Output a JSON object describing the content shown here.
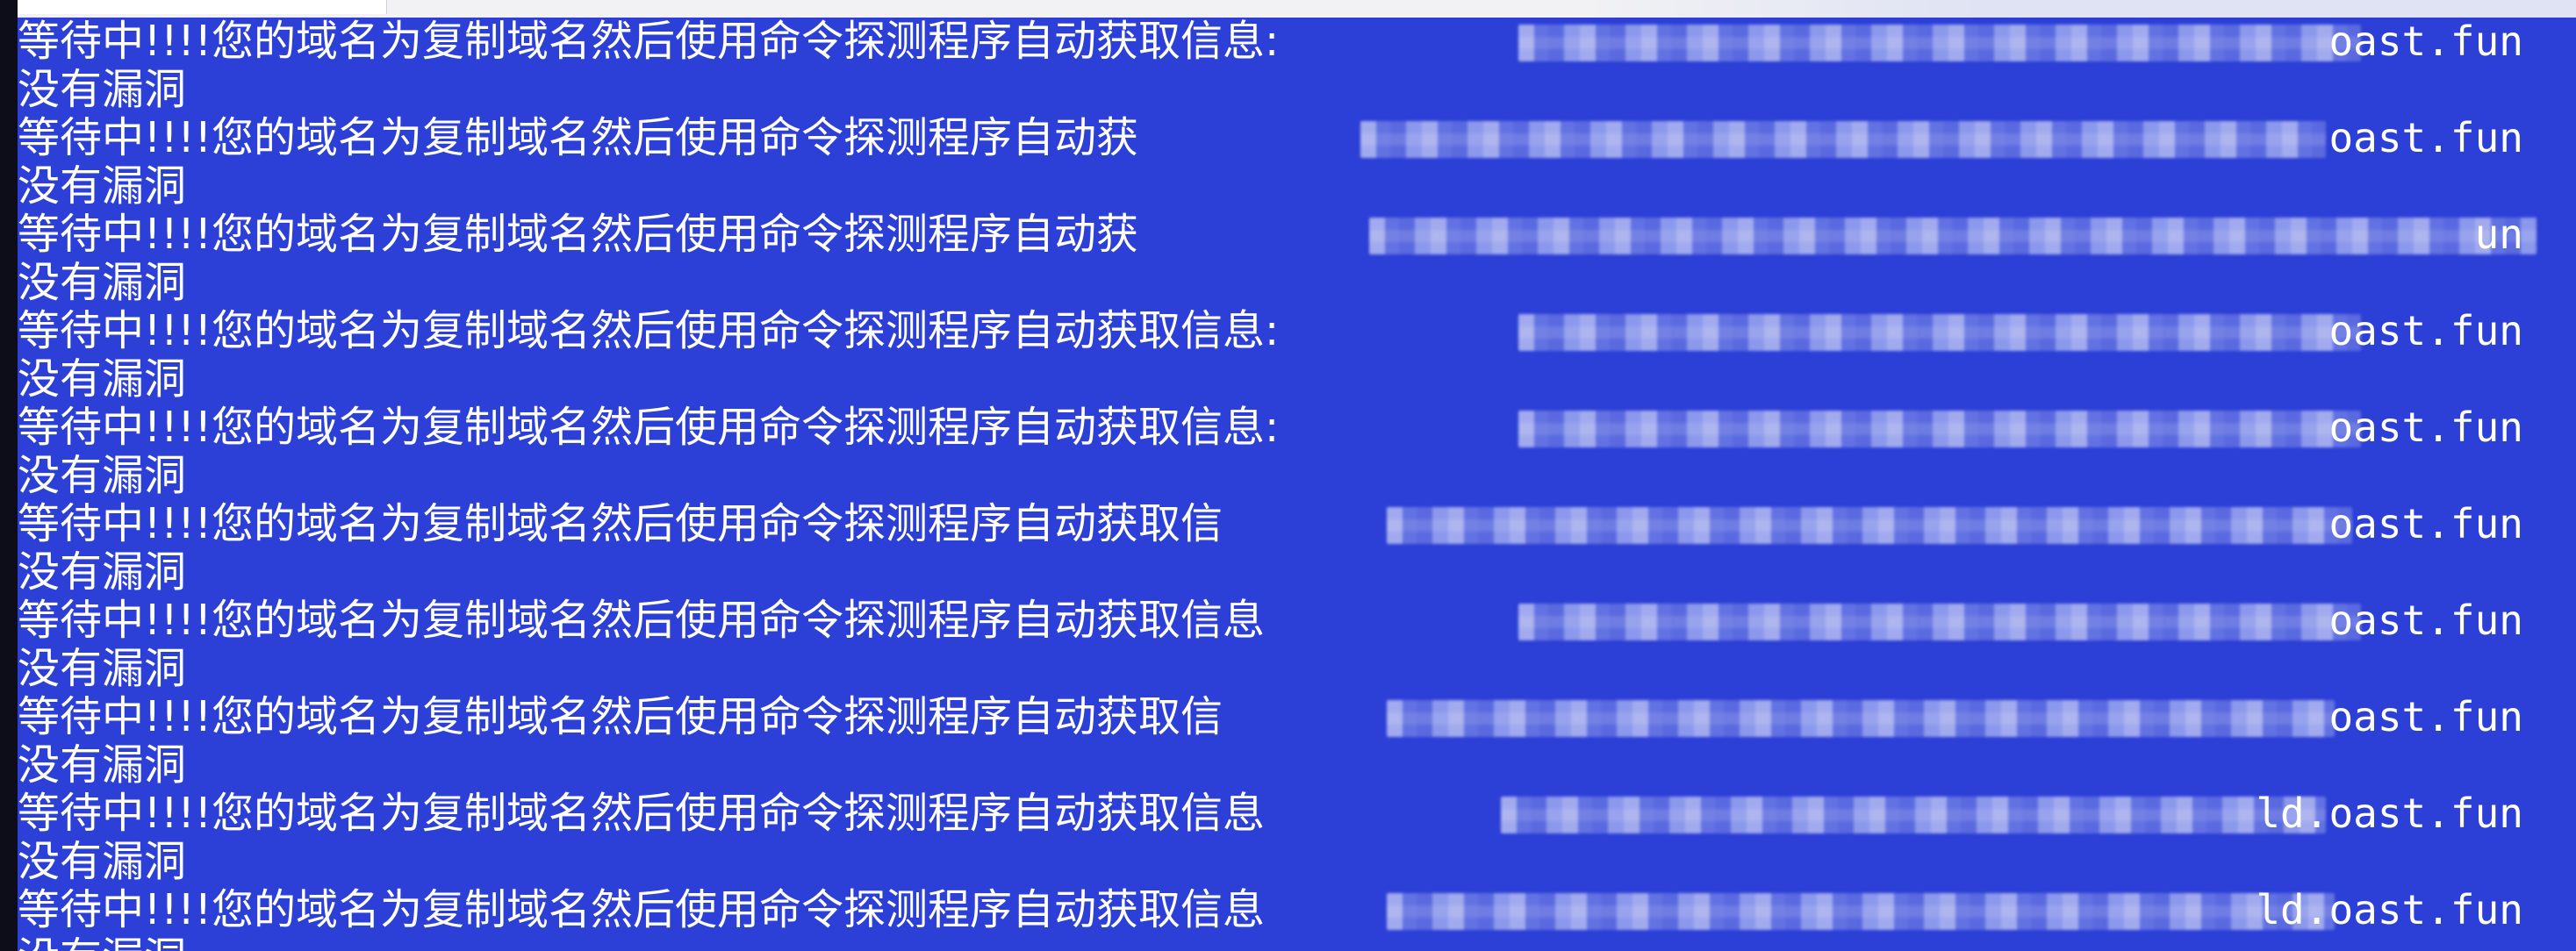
{
  "console": {
    "waiting_text": "等待中!!!!您的域名为复制域名然后使用命令探测程序自动获取信息:",
    "domain_suffix": ".oast.fun",
    "result_text": "没有漏洞",
    "rows": [
      {
        "waiting": "等待中!!!!您的域名为复制域名然后使用命令探测程序自动获取信息:",
        "suffix": "oast.fun",
        "result": "没有漏洞"
      },
      {
        "waiting": "等待中!!!!您的域名为复制域名然后使用命令探测程序自动获",
        "suffix": "oast.fun",
        "result": "没有漏洞"
      },
      {
        "waiting": "等待中!!!!您的域名为复制域名然后使用命令探测程序自动获",
        "suffix": "un",
        "result": "没有漏洞"
      },
      {
        "waiting": "等待中!!!!您的域名为复制域名然后使用命令探测程序自动获取信息:",
        "suffix": "oast.fun",
        "result": "没有漏洞"
      },
      {
        "waiting": "等待中!!!!您的域名为复制域名然后使用命令探测程序自动获取信息:",
        "suffix": "oast.fun",
        "result": "没有漏洞"
      },
      {
        "waiting": "等待中!!!!您的域名为复制域名然后使用命令探测程序自动获取信",
        "suffix": "oast.fun",
        "result": "没有漏洞"
      },
      {
        "waiting": "等待中!!!!您的域名为复制域名然后使用命令探测程序自动获取信息",
        "suffix": "oast.fun",
        "result": "没有漏洞"
      },
      {
        "waiting": "等待中!!!!您的域名为复制域名然后使用命令探测程序自动获取信",
        "suffix": "oast.fun",
        "result": "没有漏洞"
      },
      {
        "waiting": "等待中!!!!您的域名为复制域名然后使用命令探测程序自动获取信息",
        "suffix": "ld.oast.fun",
        "result": "没有漏洞"
      },
      {
        "waiting": "等待中!!!!您的域名为复制域名然后使用命令探测程序自动获取信息",
        "suffix": "ld.oast.fun",
        "result": "没有漏洞"
      }
    ]
  },
  "colors": {
    "console_bg": "#2c3fd6",
    "text": "#ffffff",
    "left_edge": "#0d0d1a"
  }
}
